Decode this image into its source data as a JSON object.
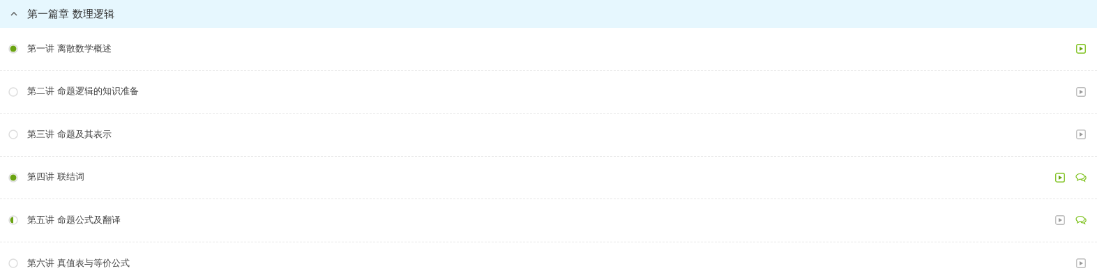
{
  "chapter": {
    "title": "第一篇章 数理逻辑",
    "expanded": true
  },
  "lessons": [
    {
      "title": "第一讲 离散数学概述",
      "kind": "done",
      "video_done": true
    },
    {
      "title": "第二讲 命题逻辑的知识准备",
      "kind": "new",
      "video_done": false
    },
    {
      "title": "第三讲 命题及其表示",
      "kind": "new",
      "video_done": false
    },
    {
      "title": "第四讲 联结词",
      "kind": "done",
      "video_done": true,
      "discussion": true
    },
    {
      "title": "第五讲 命题公式及翻译",
      "kind": "partial",
      "video_done": false,
      "discussion": true
    },
    {
      "title": "第六讲 真值表与等价公式",
      "kind": "new",
      "video_done": false
    }
  ]
}
